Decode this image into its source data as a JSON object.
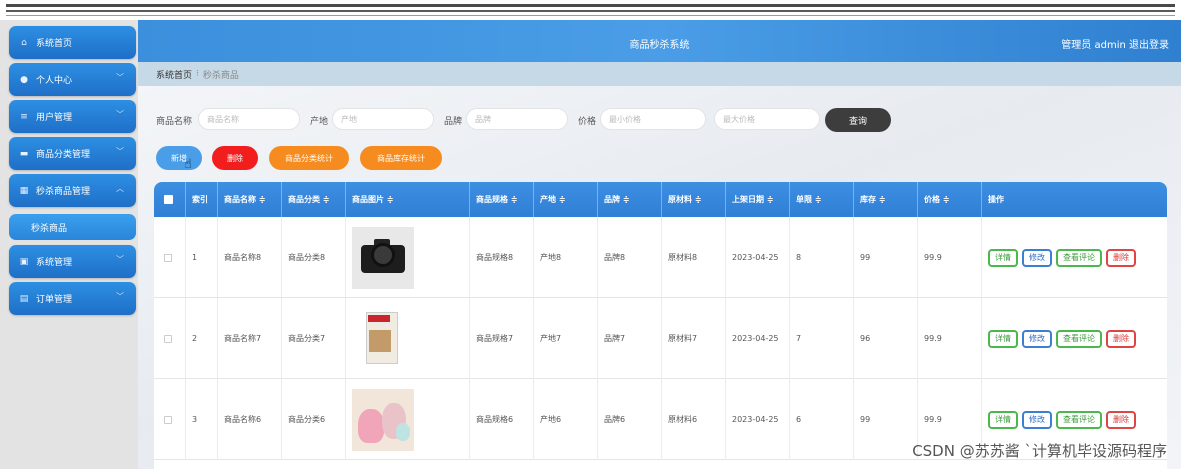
{
  "header": {
    "title": "商品秒杀系统",
    "user": "管理员 admin",
    "logout": "退出登录"
  },
  "sidebar": {
    "items": [
      {
        "label": "系统首页",
        "icon": "home-icon"
      },
      {
        "label": "个人中心",
        "icon": "user-icon"
      },
      {
        "label": "用户管理",
        "icon": "list-icon"
      },
      {
        "label": "商品分类管理",
        "icon": "category-icon"
      },
      {
        "label": "秒杀商品管理",
        "icon": "grid-icon",
        "expanded": true
      },
      {
        "label": "系统管理",
        "icon": "system-icon"
      },
      {
        "label": "订单管理",
        "icon": "order-icon"
      }
    ],
    "subitem": "秒杀商品"
  },
  "breadcrumb": {
    "home": "系统首页",
    "current": "秒杀商品"
  },
  "search": {
    "name_label": "商品名称",
    "name_placeholder": "商品名称",
    "origin_label": "产地",
    "origin_placeholder": "产地",
    "brand_label": "品牌",
    "brand_placeholder": "品牌",
    "price_label": "价格",
    "min_placeholder": "最小价格",
    "max_placeholder": "最大价格",
    "query": "查询"
  },
  "actions": {
    "add": "新增",
    "delete": "删除",
    "category_stats": "商品分类统计",
    "stock_stats": "商品库存统计"
  },
  "table": {
    "headers": [
      "索引",
      "商品名称 ≑",
      "商品分类 ≑",
      "商品图片 ≑",
      "商品规格 ≑",
      "产地 ≑",
      "品牌 ≑",
      "原材料 ≑",
      "上架日期 ≑",
      "单限 ≑",
      "库存 ≑",
      "价格 ≑",
      "操作"
    ],
    "rows": [
      {
        "index": "1",
        "name": "商品名称8",
        "category": "商品分类8",
        "image": "camera",
        "spec": "商品规格8",
        "origin": "产地8",
        "brand": "品牌8",
        "material": "原材料8",
        "date": "2023-04-25",
        "limit": "8",
        "stock": "99",
        "price": "99.9"
      },
      {
        "index": "2",
        "name": "商品名称7",
        "category": "商品分类7",
        "image": "magazine",
        "spec": "商品规格7",
        "origin": "产地7",
        "brand": "品牌7",
        "material": "原材料7",
        "date": "2023-04-25",
        "limit": "7",
        "stock": "96",
        "price": "99.9"
      },
      {
        "index": "3",
        "name": "商品名称6",
        "category": "商品分类6",
        "image": "toys",
        "spec": "商品规格6",
        "origin": "产地6",
        "brand": "品牌6",
        "material": "原材料6",
        "date": "2023-04-25",
        "limit": "6",
        "stock": "99",
        "price": "99.9"
      }
    ],
    "ops": {
      "detail": "详情",
      "edit": "修改",
      "review": "查看评论",
      "delete": "删除"
    }
  },
  "watermark": "CSDN @苏苏酱 `计算机毕设源码程序"
}
